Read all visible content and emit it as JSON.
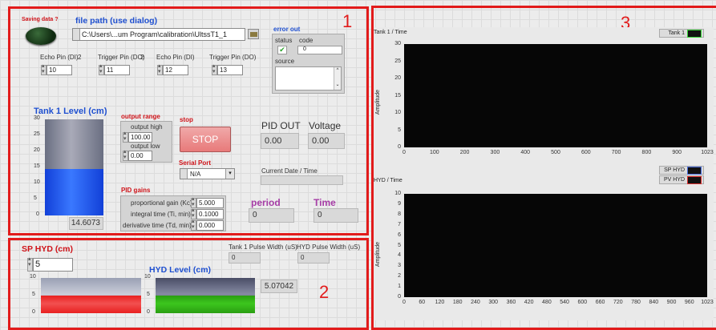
{
  "panel1": {
    "saving_label": "Saving data ?",
    "file_path_label": "file path (use dialog)",
    "file_path_value": "C:\\Users\\...um Program\\calibration\\UltssT1_1",
    "error_out": {
      "title": "error out",
      "status_label": "status",
      "code_label": "code",
      "code_value": "0",
      "source_label": "source"
    },
    "pins": [
      {
        "label": "Echo Pin (DI)",
        "value": "10"
      },
      {
        "label": "Trigger Pin (DO)",
        "value": "11"
      },
      {
        "label": "Echo Pin (DI)",
        "value": "12"
      },
      {
        "label": "Trigger Pin (DO)",
        "value": "13"
      }
    ],
    "pin_badges": [
      "2",
      "2"
    ],
    "tank_label": "Tank 1 Level (cm)",
    "tank_scale": [
      "30",
      "25",
      "20",
      "15",
      "10",
      "5",
      "0"
    ],
    "tank_fill_fraction": 0.487,
    "tank_value": "14.6073",
    "output_range": {
      "title": "output range",
      "high_label": "output high",
      "high_value": "100.00",
      "low_label": "output low",
      "low_value": "0.00"
    },
    "stop": {
      "title": "stop",
      "button": "STOP"
    },
    "pid_out": {
      "label": "PID OUT",
      "value": "0.00"
    },
    "voltage": {
      "label": "Voltage",
      "value": "0.00"
    },
    "serial_port": {
      "label": "Serial Port",
      "value": "N/A"
    },
    "current_date_label": "Current Date / Time",
    "pid_gains": {
      "title": "PID gains",
      "rows": [
        {
          "label": "proportional gain (Kc)",
          "value": "5.000"
        },
        {
          "label": "integral time (Ti, min)",
          "value": "0.1000"
        },
        {
          "label": "derivative time (Td, min)",
          "value": "0.000"
        }
      ]
    },
    "period": {
      "label": "period",
      "value": "0"
    },
    "time": {
      "label": "Time",
      "value": "0"
    },
    "marker": "1"
  },
  "panel2": {
    "sp_label": "SP HYD (cm)",
    "sp_value": "5",
    "tank1_pulse": {
      "label": "Tank 1 Pulse Width (uS)",
      "value": "0"
    },
    "hyd_pulse": {
      "label": "HYD Pulse Width (uS)",
      "value": "0"
    },
    "hyd_label": "HYD Level (cm)",
    "sp_scale": [
      "10",
      "5",
      "0"
    ],
    "hyd_scale": [
      "10",
      "5",
      "0"
    ],
    "sp_fill_fraction": 0.5,
    "hyd_fill_fraction": 0.507,
    "hyd_value": "5.07042",
    "marker": "2",
    "colors": {
      "sp_fill": "#e82020",
      "hyd_fill": "#3cc61e"
    }
  },
  "panel3": {
    "marker": "3",
    "chart1": {
      "title": "Tank 1 / Time",
      "legend": "Tank 1",
      "ylabel": "Amplitude",
      "yticks": [
        "30",
        "25",
        "20",
        "15",
        "10",
        "5",
        "0"
      ],
      "xticks": [
        "0",
        "100",
        "200",
        "300",
        "400",
        "500",
        "600",
        "700",
        "800",
        "900",
        "1023"
      ]
    },
    "chart2": {
      "title": "HYD / Time",
      "legend": [
        "SP HYD",
        "PV HYD"
      ],
      "ylabel": "Amplitude",
      "yticks": [
        "10",
        "9",
        "8",
        "7",
        "6",
        "5",
        "4",
        "3",
        "2",
        "1",
        "0"
      ],
      "xticks": [
        "0",
        "60",
        "120",
        "180",
        "240",
        "300",
        "360",
        "420",
        "480",
        "540",
        "600",
        "660",
        "720",
        "780",
        "840",
        "900",
        "960",
        "1023"
      ]
    }
  },
  "chart_data": [
    {
      "type": "line",
      "title": "Tank 1 / Time",
      "xlabel": "",
      "ylabel": "Amplitude",
      "xlim": [
        0,
        1023
      ],
      "ylim": [
        0,
        30
      ],
      "series": [
        {
          "name": "Tank 1",
          "values": []
        }
      ]
    },
    {
      "type": "line",
      "title": "HYD / Time",
      "xlabel": "",
      "ylabel": "Amplitude",
      "xlim": [
        0,
        1023
      ],
      "ylim": [
        0,
        10
      ],
      "series": [
        {
          "name": "SP HYD",
          "values": []
        },
        {
          "name": "PV HYD",
          "values": []
        }
      ]
    }
  ]
}
